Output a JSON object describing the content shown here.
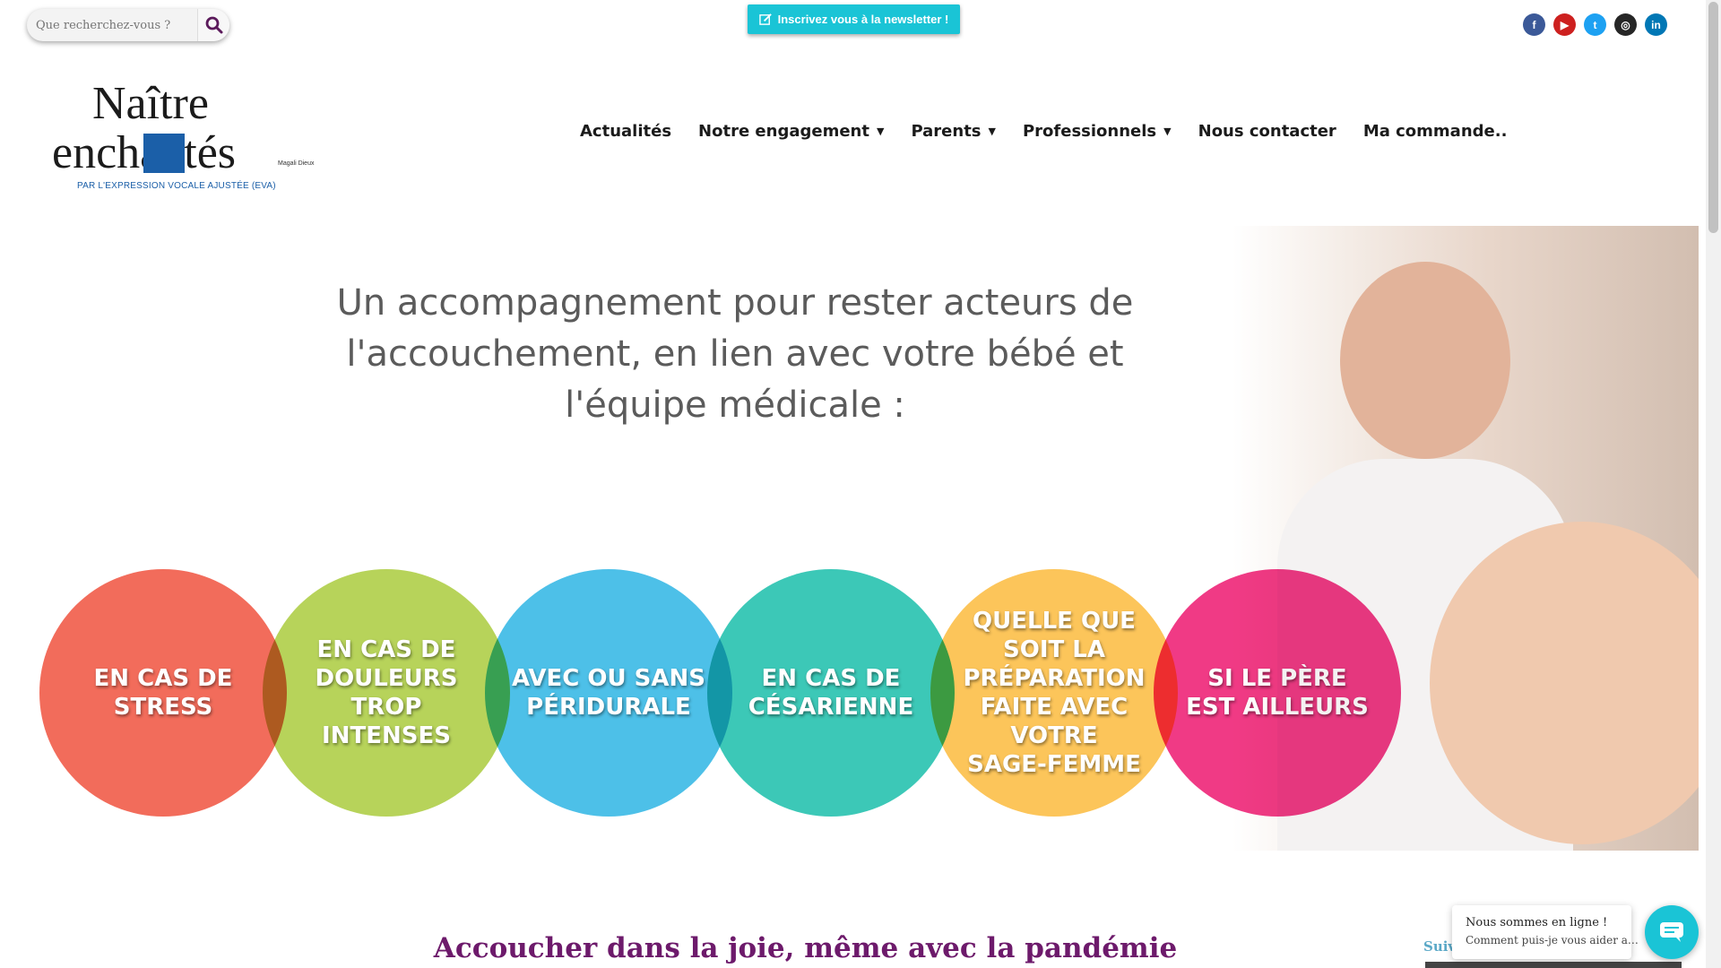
{
  "search": {
    "placeholder": "Que recherchez-vous ?"
  },
  "newsletter": {
    "label": "Inscrivez vous à la newsletter !"
  },
  "social": [
    {
      "name": "facebook",
      "color": "#3b5998",
      "glyph": "f"
    },
    {
      "name": "youtube",
      "color": "#cd201f",
      "glyph": "▶"
    },
    {
      "name": "twitter",
      "color": "#1da1f2",
      "glyph": "t"
    },
    {
      "name": "instagram",
      "color": "#262626",
      "glyph": "◎"
    },
    {
      "name": "linkedin",
      "color": "#0077b5",
      "glyph": "in"
    }
  ],
  "logo": {
    "line1": "Naître",
    "line2": "enchantés",
    "author": "Magali Dieux",
    "tagline": "PAR L'EXPRESSION VOCALE AJUSTÉE (EVA)"
  },
  "nav": [
    {
      "label": "Actualités",
      "has_menu": false
    },
    {
      "label": "Notre engagement",
      "has_menu": true
    },
    {
      "label": "Parents",
      "has_menu": true
    },
    {
      "label": "Professionnels",
      "has_menu": true
    },
    {
      "label": "Nous contacter",
      "has_menu": false
    },
    {
      "label": "Ma commande..",
      "has_menu": false
    }
  ],
  "hero": {
    "headline": "Un accompagnement pour rester acteurs de l'accouchement, en lien avec votre bébé et l'équipe médicale :",
    "circles": [
      {
        "text": "EN CAS DE\nSTRESS",
        "color": "#f26c5b"
      },
      {
        "text": "EN CAS DE\nDOULEURS\nTROP\nINTENSES",
        "color": "#b7d35a"
      },
      {
        "text": "AVEC OU SANS\nPÉRIDURALE",
        "color": "#4dc0e8"
      },
      {
        "text": "EN CAS DE\nCÉSARIENNE",
        "color": "#3cc8b7"
      },
      {
        "text": "QUELLE QUE\nSOIT LA\nPRÉPARATION\nFAITE AVEC\nVOTRE\nSAGE-FEMME",
        "color": "#fcc55a"
      },
      {
        "text": "SI LE PÈRE\nEST AILLEURS",
        "color": "#f03a85"
      }
    ]
  },
  "main": {
    "title": "Accoucher dans la joie, même avec la pandémie"
  },
  "sidebar": {
    "follow_label": "Suiv"
  },
  "chat": {
    "line1": "Nous sommes en ligne !",
    "line2": "Comment puis-je vous aider a…"
  }
}
